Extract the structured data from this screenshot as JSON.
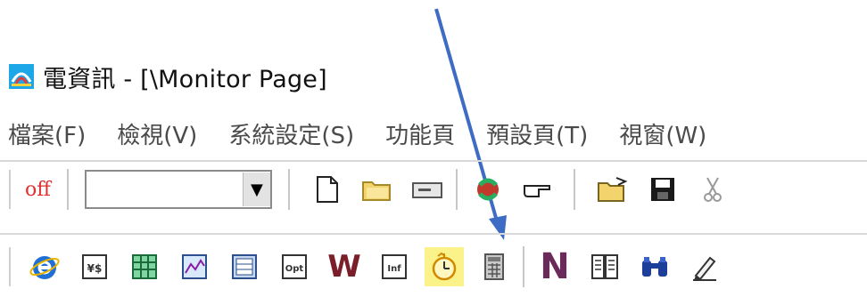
{
  "window": {
    "title": "電資訊 - [\\Monitor Page]",
    "icon": "app-logo-icon"
  },
  "menubar": {
    "items": [
      {
        "label": "檔案(F)"
      },
      {
        "label": "檢視(V)"
      },
      {
        "label": "系統設定(S)"
      },
      {
        "label": "功能頁"
      },
      {
        "label": "預設頁(T)"
      },
      {
        "label": "視窗(W)"
      }
    ]
  },
  "toolbar_top": {
    "off_label": "off",
    "combo_value": "",
    "icons": [
      "new-document-icon",
      "open-folder-icon",
      "drive-icon",
      "refresh-icon",
      "pointer-hand-icon",
      "open-file-icon",
      "save-icon",
      "cut-icon"
    ]
  },
  "toolbar_bottom": {
    "w_label": "W",
    "n_label": "N",
    "icons": [
      "internet-explorer-icon",
      "currency-icon",
      "table-icon",
      "chart-icon",
      "grid-icon",
      "option-icon",
      "w-icon",
      "info-icon",
      "alarm-clock-icon",
      "calculator-icon",
      "n-icon",
      "book-icon",
      "binoculars-icon",
      "pencil-icon"
    ]
  },
  "annotation": {
    "arrow_color": "#3d6cc4",
    "highlight_color": "#fbf38a"
  }
}
